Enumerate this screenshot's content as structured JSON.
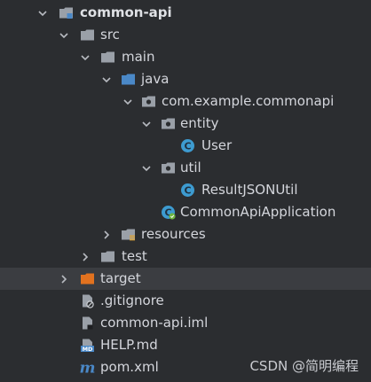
{
  "project_tree": {
    "root": {
      "label": "common-api"
    },
    "src": {
      "label": "src"
    },
    "main": {
      "label": "main"
    },
    "java": {
      "label": "java"
    },
    "package": {
      "label": "com.example.commonapi"
    },
    "entity": {
      "label": "entity"
    },
    "user_class": {
      "label": "User"
    },
    "util": {
      "label": "util"
    },
    "result_class": {
      "label": "ResultJSONUtil"
    },
    "app_class": {
      "label": "CommonApiApplication"
    },
    "resources": {
      "label": "resources"
    },
    "test": {
      "label": "test"
    },
    "target": {
      "label": "target"
    },
    "gitignore": {
      "label": ".gitignore"
    },
    "iml": {
      "label": "common-api.iml"
    },
    "help": {
      "label": "HELP.md"
    },
    "pom": {
      "label": "pom.xml"
    }
  },
  "icons": {
    "folder": "folder-icon",
    "source_folder": "source-folder-icon",
    "package": "package-icon",
    "class": "class-icon",
    "spring_app": "spring-boot-class-icon",
    "resources": "resources-folder-icon",
    "excluded_folder": "excluded-folder-icon",
    "file": "file-icon",
    "markdown": "markdown-icon",
    "maven": "maven-icon"
  },
  "watermark": "CSDN @简明编程",
  "colors": {
    "background": "#2b2d30",
    "selected_row": "#3b3d41",
    "text": "#d4d6dc",
    "folder_gray": "#9aa0a8",
    "source_blue": "#4a88c7",
    "class_teal": "#3d9bd0",
    "excluded_orange": "#e2721f"
  }
}
